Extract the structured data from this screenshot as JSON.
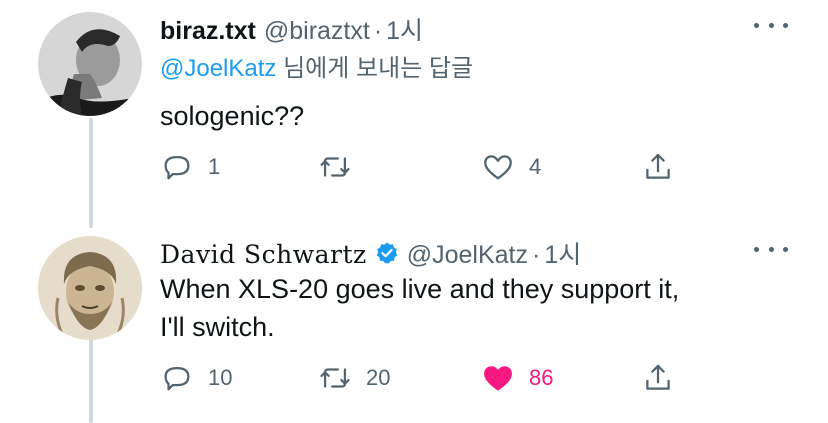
{
  "tweet1": {
    "display_name": "biraz.txt",
    "handle": "@biraztxt",
    "separator": "·",
    "time": "1시",
    "reply_mention": "@JoelKatz",
    "reply_suffix": " 님에게 보내는 답글",
    "text": "sologenic??",
    "counts": {
      "replies": "1",
      "retweets": "",
      "likes": "4"
    }
  },
  "tweet2": {
    "display_name": "David Schwartz",
    "handle": "@JoelKatz",
    "separator": "·",
    "time": "1시",
    "text_line1": "When XLS-20 goes live and they support it,",
    "text_line2": "I'll switch.",
    "counts": {
      "replies": "10",
      "retweets": "20",
      "likes": "86"
    },
    "liked": true
  },
  "icons": {
    "reply": "reply-bubble-icon",
    "retweet": "retweet-icon",
    "like": "heart-icon",
    "share": "share-upload-icon",
    "more": "more-dots-icon",
    "verified": "verified-badge-icon"
  },
  "colors": {
    "text": "#0f1419",
    "secondary": "#536471",
    "link": "#1d9bf0",
    "like_active": "#f91880",
    "thread_line": "#cfd9de"
  }
}
